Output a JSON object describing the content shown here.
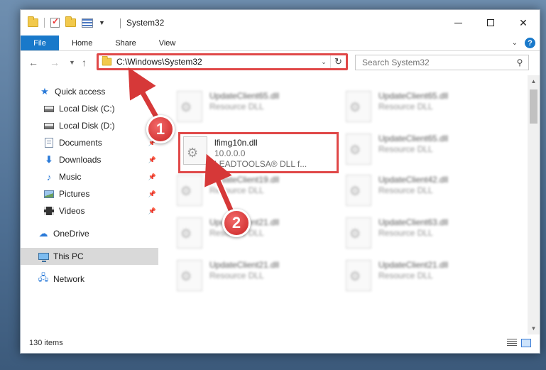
{
  "window": {
    "title": "System32",
    "controls": {
      "minimize": "minimize-icon",
      "maximize": "maximize-icon",
      "close": "✕"
    }
  },
  "ribbon": {
    "tabs": [
      "File",
      "Home",
      "Share",
      "View"
    ],
    "help": "?"
  },
  "nav": {
    "address": "C:\\Windows\\System32",
    "search_placeholder": "Search System32"
  },
  "sidebar": {
    "items": [
      {
        "label": "Quick access",
        "icon": "star-icon",
        "pinned": false
      },
      {
        "label": "Local Disk (C:)",
        "icon": "drive-icon",
        "pinned": false
      },
      {
        "label": "Local Disk (D:)",
        "icon": "drive-icon",
        "pinned": false
      },
      {
        "label": "Documents",
        "icon": "documents-icon",
        "pinned": true
      },
      {
        "label": "Downloads",
        "icon": "download-icon",
        "pinned": true
      },
      {
        "label": "Music",
        "icon": "music-icon",
        "pinned": true
      },
      {
        "label": "Pictures",
        "icon": "pictures-icon",
        "pinned": true
      },
      {
        "label": "Videos",
        "icon": "video-icon",
        "pinned": true
      },
      {
        "label": "OneDrive",
        "icon": "cloud-icon",
        "pinned": false
      },
      {
        "label": "This PC",
        "icon": "pc-icon",
        "pinned": false,
        "selected": true
      },
      {
        "label": "Network",
        "icon": "network-icon",
        "pinned": false
      }
    ]
  },
  "files": {
    "left": [
      {
        "name": "UpdateClient65.dll",
        "sub": "Resource DLL"
      },
      {
        "name": "lfimg10n.dll",
        "version": "10.0.0.0",
        "sub": "LEADTOOLSA® DLL f...",
        "highlighted": true
      },
      {
        "name": "UpdateClient19.dll",
        "sub": "Resource DLL"
      },
      {
        "name": "UpdateClient21.dll",
        "sub": "Resource DLL"
      },
      {
        "name": "UpdateClient21.dll",
        "sub": "Resource DLL"
      }
    ],
    "right": [
      {
        "name": "UpdateClient65.dll",
        "sub": "Resource DLL"
      },
      {
        "name": "UpdateClient65.dll",
        "sub": "Resource DLL"
      },
      {
        "name": "UpdateClient42.dll",
        "sub": "Resource DLL"
      },
      {
        "name": "UpdateClient63.dll",
        "sub": "Resource DLL"
      },
      {
        "name": "UpdateClient21.dll",
        "sub": "Resource DLL"
      }
    ]
  },
  "status": {
    "count": "130 items"
  },
  "callouts": [
    "1",
    "2"
  ],
  "colors": {
    "accent": "#1979ca",
    "highlight": "#e04848",
    "selected": "#d9d9d9"
  }
}
